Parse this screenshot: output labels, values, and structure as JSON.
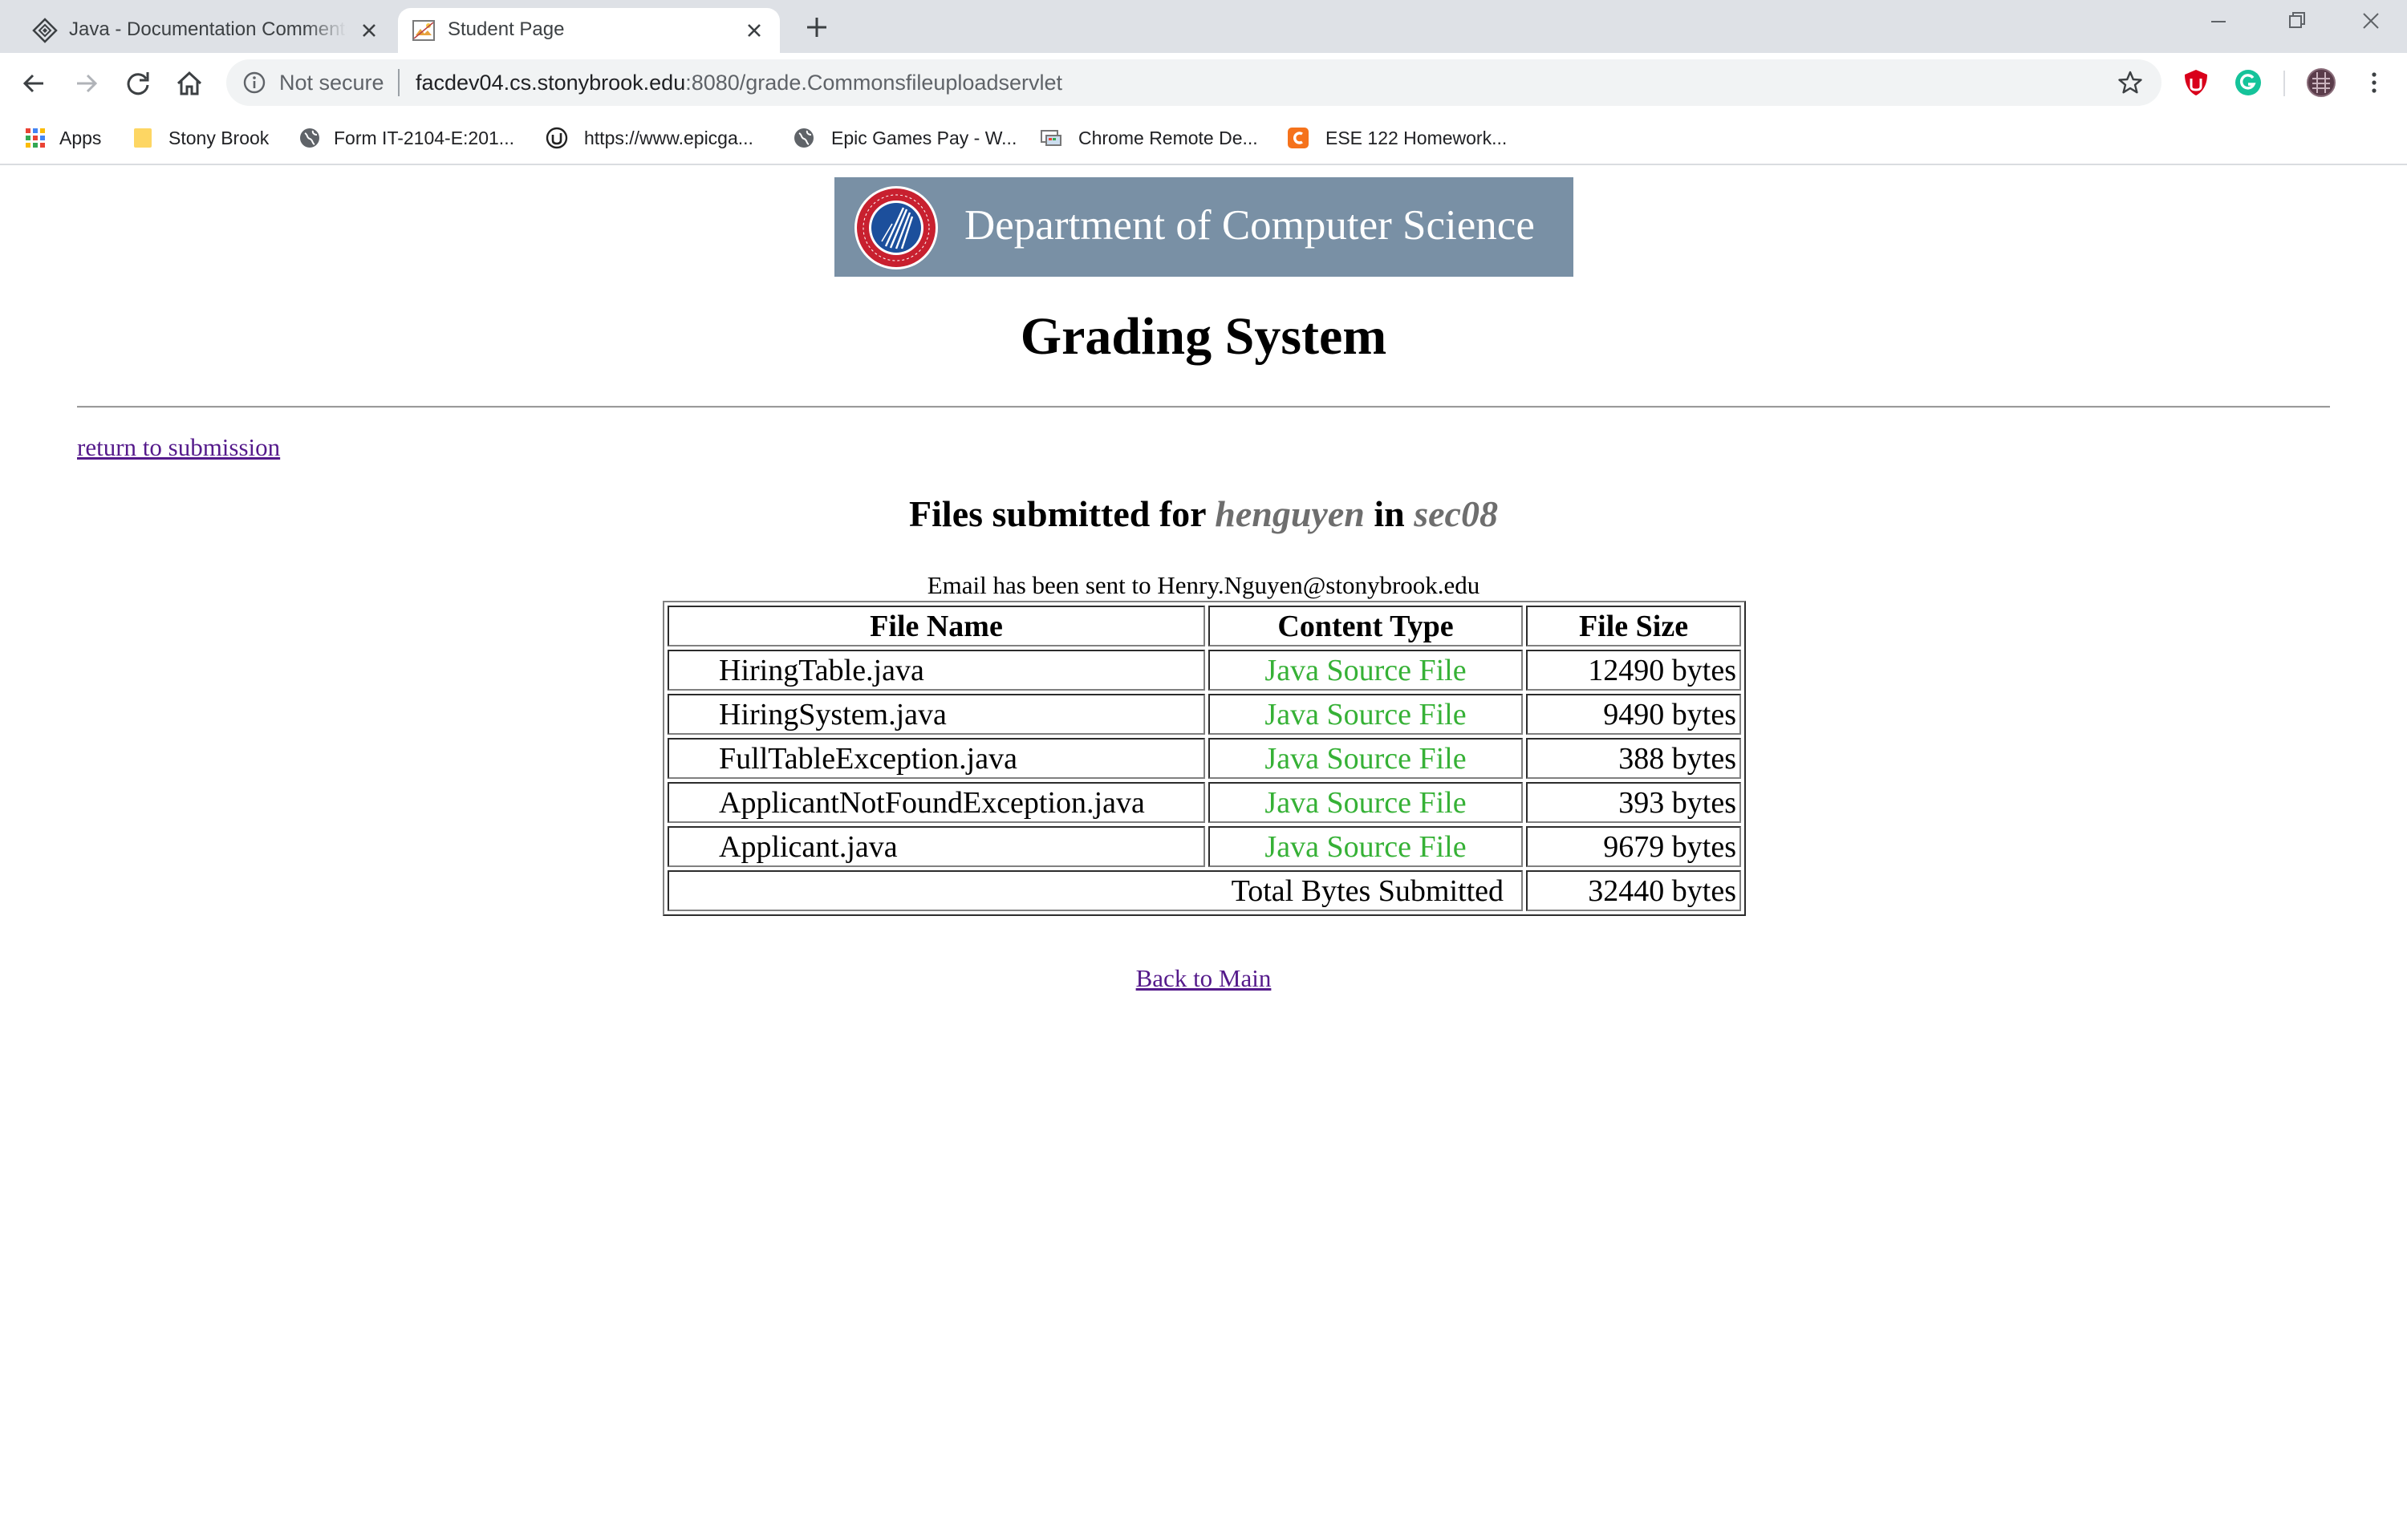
{
  "browser": {
    "tabs": [
      {
        "title": "Java - Documentation Comments",
        "active": false,
        "icon": "diamond-icon"
      },
      {
        "title": "Student Page",
        "active": true,
        "icon": "broken-image-icon"
      }
    ],
    "omnibox": {
      "security_label": "Not secure",
      "url_host": "facdev04.cs.stonybrook.edu",
      "url_path": ":8080/grade.Commonsfileuploadservlet"
    },
    "bookmarks": [
      {
        "label": "Apps",
        "icon": "apps-grid-icon"
      },
      {
        "label": "Stony Brook",
        "icon": "folder-icon"
      },
      {
        "label": "Form IT-2104-E:201...",
        "icon": "globe-icon"
      },
      {
        "label": "https://www.epicga...",
        "icon": "unreal-icon"
      },
      {
        "label": "Epic Games Pay - W...",
        "icon": "globe-icon"
      },
      {
        "label": "Chrome Remote De...",
        "icon": "remote-desktop-icon"
      },
      {
        "label": "ESE 122 Homework...",
        "icon": "chegg-icon"
      }
    ]
  },
  "page": {
    "banner_text": "Department of Computer Science",
    "seal_text": "COMPUTER SCIENCE · STONY BROOK UNIVERSITY",
    "title": "Grading System",
    "return_link": "return to submission",
    "heading_prefix": "Files submitted for",
    "heading_user": "henguyen",
    "heading_in": "in",
    "heading_section": "sec08",
    "email_notice": "Email has been sent to Henry.Nguyen@stonybrook.edu",
    "table": {
      "headers": [
        "File Name",
        "Content Type",
        "File Size"
      ],
      "rows": [
        {
          "name": "HiringTable.java",
          "type": "Java Source File",
          "size": "12490 bytes"
        },
        {
          "name": "HiringSystem.java",
          "type": "Java Source File",
          "size": "9490 bytes"
        },
        {
          "name": "FullTableException.java",
          "type": "Java Source File",
          "size": "388 bytes"
        },
        {
          "name": "ApplicantNotFoundException.java",
          "type": "Java Source File",
          "size": "393 bytes"
        },
        {
          "name": "Applicant.java",
          "type": "Java Source File",
          "size": "9679 bytes"
        }
      ],
      "total_label": "Total Bytes Submitted",
      "total_value": "32440 bytes"
    },
    "back_link": "Back to Main"
  },
  "colors": {
    "banner_bg": "#7990a5",
    "content_type_text": "#36b136",
    "link": "#551a8b",
    "italic_highlight": "#6e6e6e"
  }
}
